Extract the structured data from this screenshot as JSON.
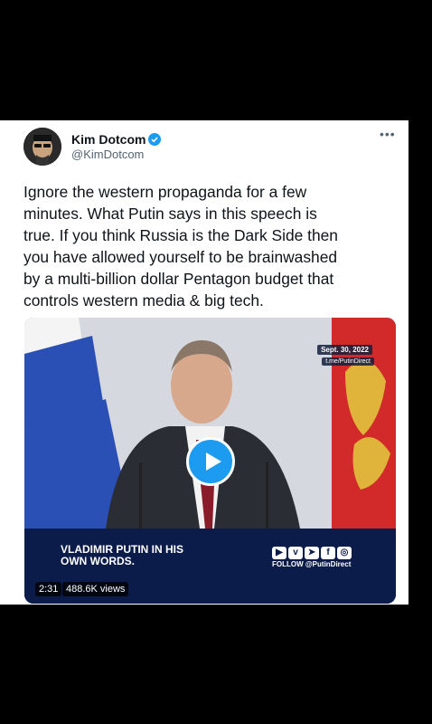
{
  "tweet": {
    "author_name": "Kim Dotcom",
    "author_handle": "@KimDotcom",
    "more_icon": "more-dots-icon",
    "verified_icon": "verified-badge-icon",
    "text": "Ignore the western propaganda for a few\nminutes. What Putin says in this speech is\ntrue. If you think Russia is the Dark Side then\nyou have allowed yourself to be brainwashed\nby a multi-billion dollar Pentagon budget that\ncontrols western media & big tech."
  },
  "video": {
    "stamp_date": "Sept. 30, 2022",
    "stamp_link": "t.me/PutinDirect",
    "banner_title": "VLADIMIR PUTIN IN HIS OWN WORDS.",
    "follow_text": "FOLLOW @PutinDirect",
    "duration": "2:31",
    "views": "488.6K views",
    "play_icon": "play-icon",
    "social_icons": [
      "youtube-icon",
      "vk-icon",
      "telegram-icon",
      "facebook-icon",
      "instagram-icon"
    ]
  },
  "colors": {
    "accent": "#1d9bf0",
    "banner": "#0c1c4a"
  }
}
